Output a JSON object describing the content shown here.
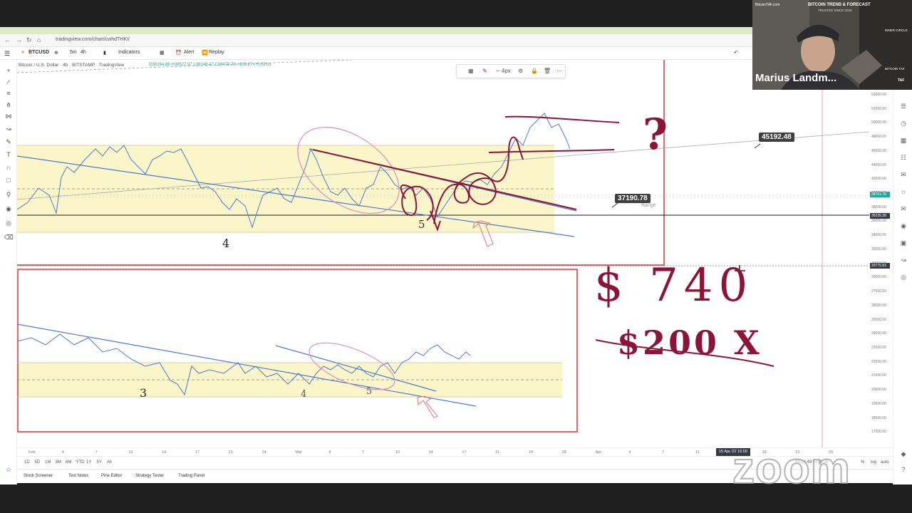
{
  "browser": {
    "url": "tradingview.com/chart/cwhdTHKI/"
  },
  "toolbar": {
    "symbol": "BTCUSD",
    "interval_menu": "5m",
    "interval": "4h",
    "indicators": "Indicators",
    "alert": "Alert",
    "replay": "Replay"
  },
  "chart": {
    "title": "Bitcoin / U.S. Dollar · 4h · BITSTAMP · TradingView",
    "ohlc": "O38164.88 H38527.97 L38146.47 C38478.78 +309.27 (+0.81%)",
    "price_label_a": "45192.48",
    "price_label_b": "37190.78",
    "range_text": "Range",
    "wave_labels": [
      "4",
      "5",
      "3",
      "4",
      "5"
    ],
    "annotations": [
      "?",
      "$ 740",
      "$200 X"
    ]
  },
  "price_axis": {
    "ticks": [
      "53000.00",
      "52000.00",
      "50000.00",
      "48000.00",
      "46000.00",
      "44000.00",
      "42000.00",
      "40000.00",
      "38000.00",
      "36000.00",
      "34000.00",
      "32000.00",
      "30000.00",
      "29000.00",
      "27500.00",
      "26000.00",
      "25500.00",
      "24500.00",
      "23500.00",
      "22500.00",
      "21500.00",
      "20500.00",
      "19500.00",
      "18500.00",
      "17500.00"
    ],
    "tags": [
      {
        "text": "38761.76",
        "color": "#26a69a"
      },
      {
        "text": "36235.38",
        "color": "#363a45"
      },
      {
        "text": "30775.83",
        "color": "#363a45"
      }
    ]
  },
  "time_axis": {
    "ticks": [
      "Feb",
      "4",
      "7",
      "10",
      "14",
      "17",
      "21",
      "24",
      "Mar",
      "4",
      "7",
      "10",
      "14",
      "17",
      "21",
      "24",
      "28",
      "Apr",
      "4",
      "7",
      "11",
      "14",
      "18",
      "21",
      "25"
    ],
    "cursor_date": "15 Apr '22 16:00"
  },
  "range_bar": {
    "buttons": [
      "1D",
      "5D",
      "1M",
      "3M",
      "6M",
      "YTD",
      "1Y",
      "5Y",
      "All"
    ],
    "time": "09:24:49 (UTC-4)",
    "percent": "%",
    "log": "log",
    "auto": "auto"
  },
  "bottom_tabs": [
    "Stock Screener",
    "Text Notes",
    "Pine Editor",
    "Strategy Tester",
    "Trading Panel"
  ],
  "video": {
    "participant_name": "Marius Landm...",
    "site": "BitcoinTAF.com",
    "banner": "BITCOIN TREND & FORECAST",
    "banner_sub": "TRUSTED SINCE 2016",
    "sidebar_items": [
      "INNER CIRCLE",
      "BITCOIN TAF",
      "TAF"
    ]
  },
  "watermark": "zoom",
  "colors": {
    "highlight": "#fbf6c9",
    "red_frame": "#d9353f",
    "trendline": "#4b7bd1",
    "price_line": "#4b7bd1",
    "pen": "#8b1538",
    "ellipse": "#d98ec8"
  }
}
